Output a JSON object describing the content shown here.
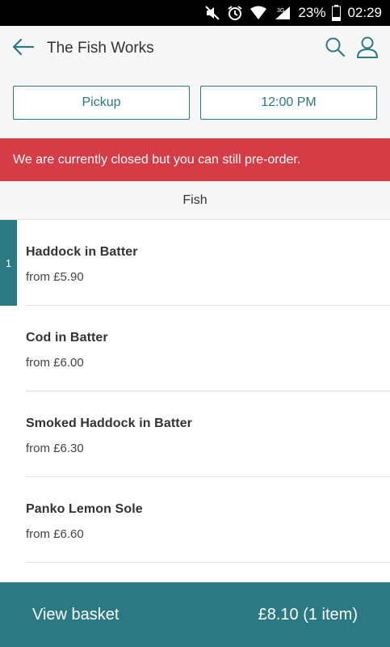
{
  "status_bar": {
    "battery": "23%",
    "time": "02:29",
    "network": "3G"
  },
  "header": {
    "title": "The Fish Works"
  },
  "order_options": {
    "mode": "Pickup",
    "time": "12:00 PM"
  },
  "alert": {
    "message": "We are currently closed but you can still pre-order."
  },
  "category": {
    "title": "Fish"
  },
  "menu": {
    "items": [
      {
        "name": "Haddock in Batter",
        "price": "from £5.90",
        "quantity": "1"
      },
      {
        "name": "Cod in Batter",
        "price": "from £6.00"
      },
      {
        "name": "Smoked Haddock in Batter",
        "price": "from £6.30"
      },
      {
        "name": "Panko Lemon Sole",
        "price": "from £6.60"
      }
    ]
  },
  "basket": {
    "label": "View basket",
    "total": "£8.10 (1 item)"
  },
  "colors": {
    "accent": "#2b7a83",
    "alert": "#d63c46"
  }
}
